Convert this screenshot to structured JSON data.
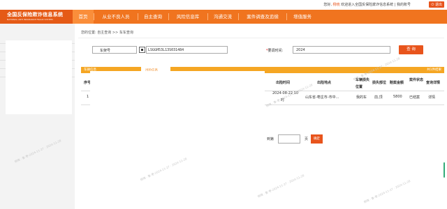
{
  "header": {
    "welcome_prefix": "您好,",
    "username": "杨晓",
    "welcome_suffix": "欢迎进入全国反保险欺诈信息系统",
    "my_account": "| 我的账号",
    "logout": "退出"
  },
  "logo": {
    "title": "全国反保险欺诈信息系统",
    "subtitle": "NATIONAL ANTI INSURANCE FRAUD SYSTEM"
  },
  "nav": {
    "items": [
      "首页",
      "从业不良人员",
      "自主查询",
      "风险信息库",
      "沟通交流",
      "案件调查及追偿",
      "增值服务"
    ],
    "active_index": 0
  },
  "breadcrumb": "您的位置: 自主查询 >> 车车查询",
  "search": {
    "type_value": "车架号",
    "vin_value": "LSGGH53L13S031484",
    "date_label": "要调时间:",
    "date_required": "*",
    "date_value": "2024",
    "query_button": "查 询"
  },
  "tabs": {
    "tab1": "车辆信息",
    "tab2": "出险信息",
    "right": "共1件结果"
  },
  "table": {
    "headers": [
      "序号",
      "出险时间",
      "出险地点",
      "车辆损失位置",
      "损失部位",
      "赔案金额",
      "案件状态",
      "查询详情"
    ],
    "row": {
      "index": "1",
      "time_line1": "2024-08-22 10",
      "time_line2": "时",
      "place": "山东省-枣庄市-市中...",
      "car_loss": "我的车",
      "part": "前,顶",
      "amount": "5800",
      "status": "已结案",
      "detail": "详情"
    }
  },
  "pager": {
    "goto_label": "到第",
    "page_unit": "页",
    "confirm": "确定"
  },
  "watermark": "杨晓 · 鲁-枣-2024-11-27 · 2024-11-28",
  "colors": {
    "nav": "#f0741f",
    "logo_bg": "#e55a16",
    "accent": "#e8541c",
    "tab": "#f5a623"
  }
}
